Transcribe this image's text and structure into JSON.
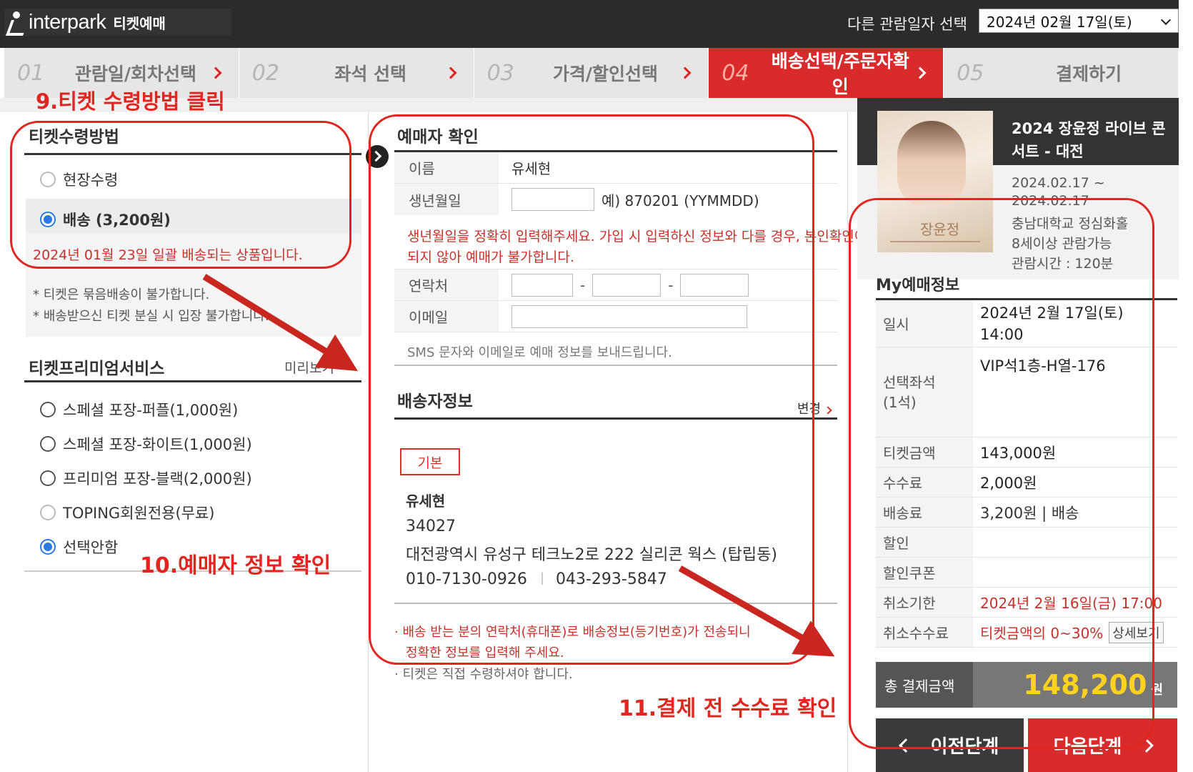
{
  "header": {
    "logo_text": "interpark",
    "logo_sub": "티켓예매",
    "date_label": "다른 관람일자 선택",
    "date_value": "2024년 02월 17일(토)"
  },
  "steps": [
    {
      "num": "01",
      "label": "관람일/회차선택"
    },
    {
      "num": "02",
      "label": "좌석 선택"
    },
    {
      "num": "03",
      "label": "가격/할인선택"
    },
    {
      "num": "04",
      "label": "배송선택/주문자확인"
    },
    {
      "num": "05",
      "label": "결제하기"
    }
  ],
  "receive": {
    "title": "티켓수령방법",
    "option1": "현장수령",
    "option2": "배송 (3,200원)",
    "delivery_note": "2024년 01월 23일 일괄 배송되는 상품입니다.",
    "note1": "* 티켓은 묶음배송이 불가합니다.",
    "note2": "* 배송받으신 티켓 분실 시 입장 불가합니다."
  },
  "premium": {
    "title": "티켓프리미엄서비스",
    "preview": "미리보기",
    "options": [
      "스페셜 포장-퍼플(1,000원)",
      "스페셜 포장-화이트(1,000원)",
      "프리미엄 포장-블랙(2,000원)",
      "TOPING회원전용(무료)",
      "선택안함"
    ]
  },
  "buyer": {
    "title": "예매자 확인",
    "name_label": "이름",
    "name_value": "유세현",
    "birth_label": "생년월일",
    "birth_hint": "예) 870201 (YYMMDD)",
    "birth_warning_1": "생년월일을 정확히 입력해주세요. 가입 시 입력하신 정보와 다를 경우, 본인확인이",
    "birth_warning_2": "되지 않아 예매가 불가합니다.",
    "phone_label": "연락처",
    "phone_dash": "-",
    "email_label": "이메일",
    "sms_note": "SMS 문자와 이메일로 예매 정보를 보내드립니다."
  },
  "shipping": {
    "title": "배송자정보",
    "change": "변경",
    "badge": "기본",
    "name": "유세현",
    "zip": "34027",
    "address": "대전광역시 유성구 테크노2로 222 실리콘 웍스 (탑립동)",
    "phone1": "010-7130-0926",
    "separator": "|",
    "phone2": "043-293-5847",
    "note1": "· 배송 받는 분의 연락처(휴대폰)로 배송정보(등기번호)가 전송되니",
    "note1b": "정확한 정보를 입력해 주세요.",
    "note2": "· 티켓은 직접 수령하셔야 합니다."
  },
  "product": {
    "title": "2024 장윤정 라이브 콘서트 - 대전",
    "dates_1": "2024.02.17 ~",
    "dates_2": "2024.02.17",
    "venue": "충남대학교 정심화홀",
    "age": "8세이상 관람가능",
    "runtime": "관람시간 : 120분",
    "poster_title": "장윤정"
  },
  "myinfo": {
    "title": "My예매정보",
    "date_label": "일시",
    "date_value_1": "2024년 2월 17일(토)",
    "date_value_2": "14:00",
    "seat_label_1": "선택좌석",
    "seat_label_2": "(1석)",
    "seat_value": "VIP석1층-H열-176",
    "price_label": "티켓금액",
    "price_value": "143,000원",
    "fee_label": "수수료",
    "fee_value": "2,000원",
    "ship_label": "배송료",
    "ship_value": "3,200원 | 배송",
    "discount_label": "할인",
    "coupon_label": "할인쿠폰",
    "cancel_deadline_label": "취소기한",
    "cancel_deadline_value": "2024년 2월 16일(금) 17:00",
    "cancel_fee_label": "취소수수료",
    "cancel_fee_value": "티켓금액의 0~30%",
    "detail_btn": "상세보기",
    "total_label": "총 결제금액",
    "total_value": "148,200",
    "total_unit": "원"
  },
  "nav": {
    "prev": "이전단계",
    "next": "다음단계"
  },
  "annotations": {
    "a9": "9.티켓 수령방법 클릭",
    "a10": "10.예매자 정보 확인",
    "a11": "11.결제 전 수수료 확인"
  },
  "colors": {
    "accent": "#d92b2b",
    "annotation": "#e0261f",
    "total": "#ffd21e"
  }
}
